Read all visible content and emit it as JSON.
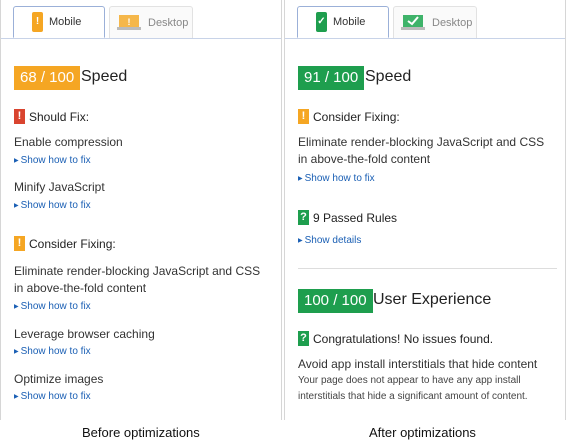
{
  "colors": {
    "orange": "#f5a623",
    "green": "#1e9e4e",
    "red": "#d9442f",
    "link": "#1a5fb4"
  },
  "before": {
    "tabs": {
      "mobile": "Mobile",
      "desktop": "Desktop",
      "mobile_icon": "phone-warning-icon",
      "desktop_icon": "monitor-warning-icon"
    },
    "score": "68 / 100",
    "score_label": "Speed",
    "should_fix": {
      "heading": "Should Fix:",
      "items": [
        {
          "title": "Enable compression",
          "link": "Show how to fix"
        },
        {
          "title": "Minify JavaScript",
          "link": "Show how to fix"
        }
      ]
    },
    "consider_fixing": {
      "heading": "Consider Fixing:",
      "items": [
        {
          "title": "Eliminate render-blocking JavaScript and CSS in above-the-fold content",
          "link": "Show how to fix"
        },
        {
          "title": "Leverage browser caching",
          "link": "Show how to fix"
        },
        {
          "title": "Optimize images",
          "link": "Show how to fix"
        }
      ]
    }
  },
  "after": {
    "tabs": {
      "mobile": "Mobile",
      "desktop": "Desktop",
      "mobile_icon": "phone-check-icon",
      "desktop_icon": "monitor-check-icon"
    },
    "score": "91 / 100",
    "score_label": "Speed",
    "consider_fixing": {
      "heading": "Consider Fixing:",
      "items": [
        {
          "title": "Eliminate render-blocking JavaScript and CSS in above-the-fold content",
          "link": "Show how to fix"
        }
      ]
    },
    "passed": {
      "heading": "9 Passed Rules",
      "link": "Show details"
    },
    "ux_score": "100 / 100",
    "ux_label": "User Experience",
    "congrats": "Congratulations! No issues found.",
    "ux_rule_title": "Avoid app install interstitials that hide content",
    "ux_rule_desc": "Your page does not appear to have any app install interstitials that hide a significant amount of content."
  },
  "captions": {
    "before": "Before optimizations",
    "after": "After optimizations"
  }
}
